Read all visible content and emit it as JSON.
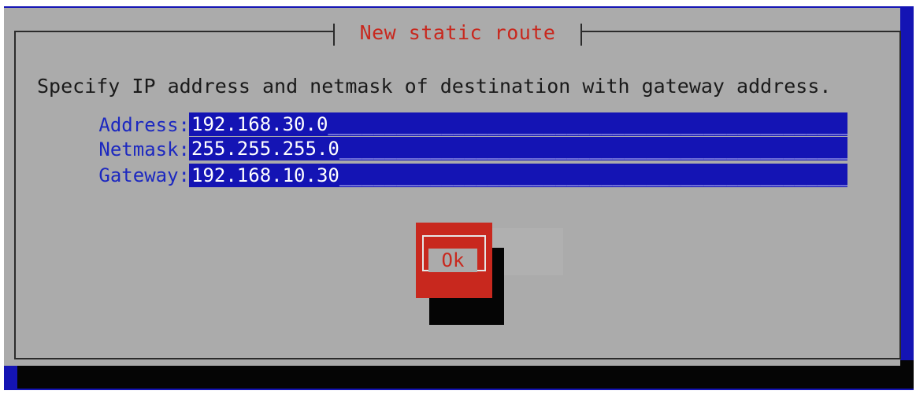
{
  "dialog": {
    "title": "New static route",
    "prompt": "Specify IP address and netmask of destination with gateway address.",
    "fields": [
      {
        "label": "Address:",
        "value": "192.168.30.0"
      },
      {
        "label": "Netmask:",
        "value": "255.255.255.0"
      },
      {
        "label": "Gateway:",
        "value": "192.168.10.30"
      }
    ],
    "ok_label": "Ok"
  },
  "colors": {
    "screen_background": "#1414b4",
    "dialog_background": "#ababab",
    "title_text": "#c8281e",
    "label_text": "#1c28c0",
    "input_background": "#1414b4",
    "button_background": "#c8281e",
    "shadow": "#050505"
  }
}
